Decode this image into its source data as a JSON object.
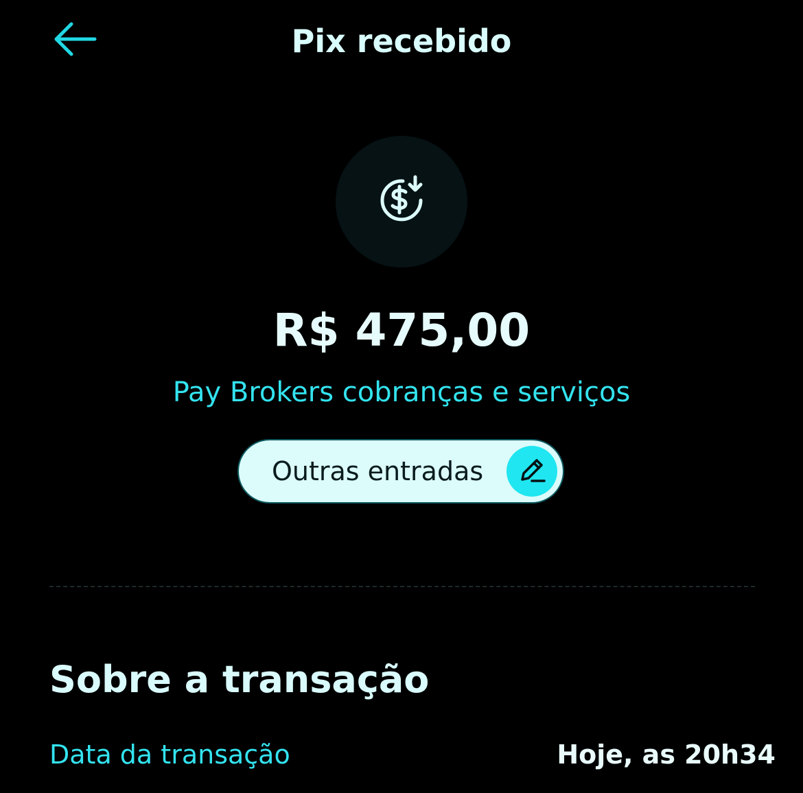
{
  "header": {
    "title": "Pix recebido",
    "back_icon": "arrow-left-icon"
  },
  "transaction": {
    "icon": "dollar-receive-icon",
    "amount": "R$ 475,00",
    "payer": "Pay Brokers cobranças e serviços",
    "category": "Outras entradas",
    "edit_icon": "pencil-icon"
  },
  "details": {
    "section_title": "Sobre a transação",
    "rows": [
      {
        "label": "Data da transação",
        "value": "Hoje, as 20h34"
      }
    ]
  },
  "colors": {
    "background": "#000000",
    "accent": "#1fe6f0",
    "accent_text": "#33e3ef",
    "primary_text": "#d9fbfb",
    "pill_background": "#dcfbfb"
  }
}
